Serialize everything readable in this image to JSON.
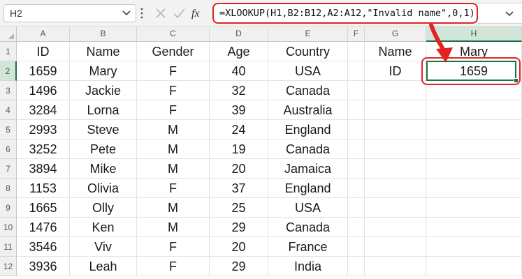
{
  "formula_bar": {
    "name_box": "H2",
    "formula": "=XLOOKUP(H1,B2:B12,A2:A12,\"Invalid name\",0,1)",
    "icons": [
      "chevron-down-icon",
      "more-vertical-icon",
      "cancel-icon",
      "check-icon",
      "function-icon",
      "expand-icon"
    ]
  },
  "columns": [
    "A",
    "B",
    "C",
    "D",
    "E",
    "F",
    "G",
    "H"
  ],
  "rows": [
    "1",
    "2",
    "3",
    "4",
    "5",
    "6",
    "7",
    "8",
    "9",
    "10",
    "11",
    "12"
  ],
  "sheet": {
    "headers": [
      "ID",
      "Name",
      "Gender",
      "Age",
      "Country"
    ],
    "data": [
      [
        "1659",
        "Mary",
        "F",
        "40",
        "USA"
      ],
      [
        "1496",
        "Jackie",
        "F",
        "32",
        "Canada"
      ],
      [
        "3284",
        "Lorna",
        "F",
        "39",
        "Australia"
      ],
      [
        "2993",
        "Steve",
        "M",
        "24",
        "England"
      ],
      [
        "3252",
        "Pete",
        "M",
        "19",
        "Canada"
      ],
      [
        "3894",
        "Mike",
        "M",
        "20",
        "Jamaica"
      ],
      [
        "1153",
        "Olivia",
        "F",
        "37",
        "England"
      ],
      [
        "1665",
        "Olly",
        "M",
        "25",
        "USA"
      ],
      [
        "1476",
        "Ken",
        "M",
        "29",
        "Canada"
      ],
      [
        "3546",
        "Viv",
        "F",
        "20",
        "France"
      ],
      [
        "3936",
        "Leah",
        "F",
        "29",
        "India"
      ]
    ]
  },
  "lookup": {
    "name_label": "Name",
    "name_value": "Mary",
    "id_label": "ID",
    "id_value": "1659"
  },
  "active_cell": "H2",
  "colors": {
    "accent_green": "#1e7145",
    "annotation_red": "#e12323"
  }
}
